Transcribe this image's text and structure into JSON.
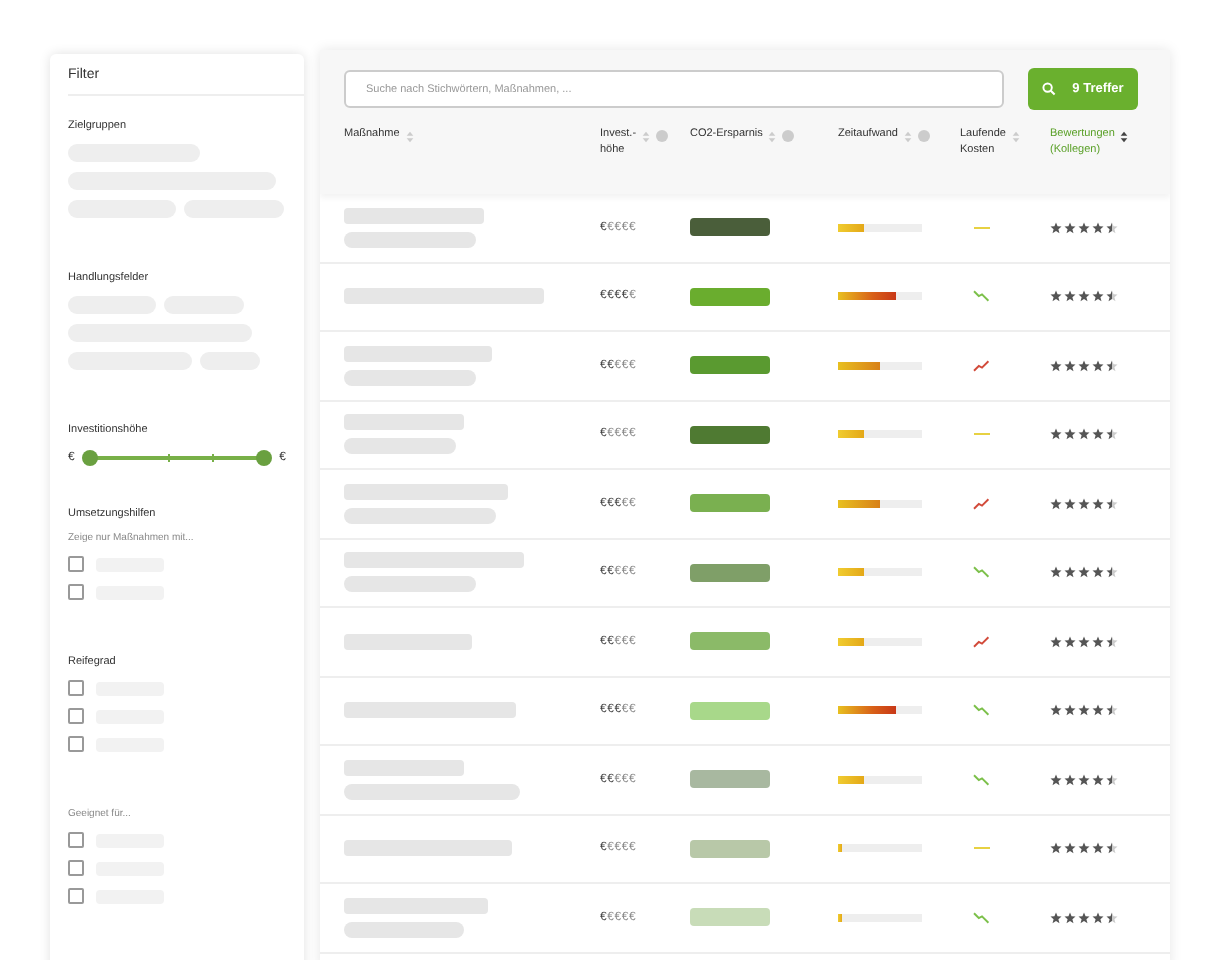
{
  "sidebar": {
    "title": "Filter",
    "groups": [
      {
        "kind": "chips",
        "title": "Zielgruppen"
      },
      {
        "kind": "chips",
        "title": "Handlungsfelder"
      },
      {
        "kind": "range",
        "title": "Investitionshöhe",
        "min_label": "€",
        "max_label": "€",
        "level": 1
      },
      {
        "kind": "checks",
        "title": "Umsetzungshilfen",
        "hint": "Zeige nur Maßnahmen mit...",
        "options": [
          {
            "checked": false
          },
          {
            "checked": false
          }
        ]
      },
      {
        "kind": "checks",
        "title": "Reifegrad",
        "options": [
          {
            "checked": false
          },
          {
            "checked": false
          },
          {
            "checked": false
          }
        ]
      },
      {
        "kind": "checks",
        "hint": "Geeignet für...",
        "options": [
          {
            "checked": false
          },
          {
            "checked": false
          },
          {
            "checked": false
          }
        ]
      }
    ]
  },
  "search": {
    "placeholder": "Suche nach Stichwörtern, Maßnahmen, ...",
    "button": "9 Treffer"
  },
  "table": {
    "columns": [
      {
        "label": "Maßnahme",
        "sortable": true,
        "info": false,
        "sorted": false
      },
      {
        "label": "Invest.-\nhöhe",
        "sortable": true,
        "info": true,
        "sorted": false
      },
      {
        "label": "CO2-Ersparnis",
        "sortable": true,
        "info": true,
        "sorted": false
      },
      {
        "label": "Zeitaufwand",
        "sortable": true,
        "info": true,
        "sorted": false
      },
      {
        "label": "Laufende\nKosten",
        "sortable": true,
        "info": false,
        "sorted": false
      },
      {
        "label": "Bewertungen\n(Kollegen)",
        "sortable": true,
        "info": false,
        "sorted": true
      }
    ],
    "rows": [
      {
        "invest_on": "€",
        "invest_off": "€€€€",
        "color": "#4a5e3a",
        "level": 0.3,
        "kind": "flat",
        "stars": 4.5
      },
      {
        "invest_on": "€€€€",
        "invest_off": "€",
        "color": "#6aad2e",
        "level": 0.7,
        "kind": "down",
        "stars": 4.5
      },
      {
        "invest_on": "€€",
        "invest_off": "€€€",
        "color": "#5a9a30",
        "level": 0.5,
        "kind": "up",
        "stars": 4.5
      },
      {
        "invest_on": "€",
        "invest_off": "€€€€",
        "color": "#4f7a32",
        "level": 0.3,
        "kind": "flat",
        "stars": 4.5
      },
      {
        "invest_on": "€€€",
        "invest_off": "€€",
        "color": "#7ab050",
        "level": 0.5,
        "kind": "up",
        "stars": 4.5
      },
      {
        "invest_on": "€€",
        "invest_off": "€€€",
        "color": "#7f9f68",
        "level": 0.3,
        "kind": "down",
        "stars": 4.5
      },
      {
        "invest_on": "€€",
        "invest_off": "€€€",
        "color": "#8bba68",
        "level": 0.3,
        "kind": "up",
        "stars": 4.5
      },
      {
        "invest_on": "€€€",
        "invest_off": "€€",
        "color": "#a8d88a",
        "level": 0.7,
        "kind": "down",
        "stars": 4.5
      },
      {
        "invest_on": "€€",
        "invest_off": "€€€",
        "color": "#a8b8a0",
        "level": 0.3,
        "kind": "down",
        "stars": 4.5
      },
      {
        "invest_on": "€",
        "invest_off": "€€€€",
        "color": "#b8c8a8",
        "level": 0.05,
        "kind": "flat",
        "stars": 4.5
      },
      {
        "invest_on": "€",
        "invest_off": "€€€€",
        "color": "#c8dcb8",
        "level": 0.05,
        "kind": "down",
        "stars": 4.5
      }
    ]
  }
}
